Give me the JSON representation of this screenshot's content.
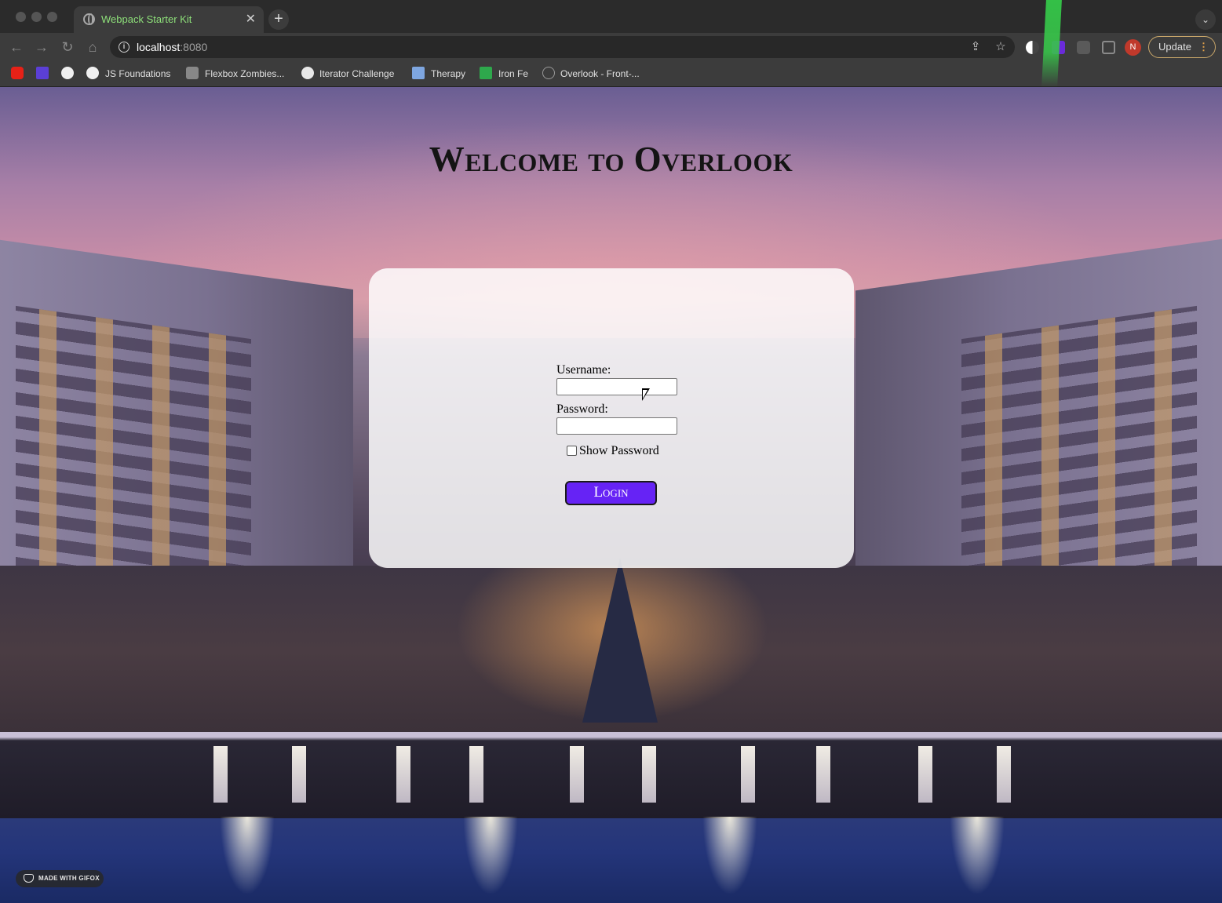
{
  "browser": {
    "tab_title": "Webpack Starter Kit",
    "tab_close": "✕",
    "new_tab": "+",
    "tab_menu": "⌄",
    "url_host": "localhost",
    "url_port": ":8080",
    "update_label": "Update",
    "update_dots": "⋮",
    "avatar_initial": "N",
    "info_glyph": "i",
    "nav": {
      "back": "←",
      "forward": "→",
      "reload": "↻",
      "home": "⌂"
    },
    "omni": {
      "share": "⇪",
      "star": "☆"
    }
  },
  "bookmarks": [
    {
      "label": "JS Foundations",
      "icon": "github-icon"
    },
    {
      "label": "Flexbox Zombies...",
      "icon": "zombie-icon"
    },
    {
      "label": "Iterator Challenge",
      "icon": "iterator-icon"
    },
    {
      "label": "Therapy",
      "icon": "therapy-icon"
    },
    {
      "label": "Iron Fe",
      "icon": "ironfe-icon"
    },
    {
      "label": "Overlook - Front-...",
      "icon": "overlook-icon"
    }
  ],
  "page": {
    "title": "Welcome to Overlook",
    "username_label": "Username:",
    "username_value": "",
    "password_label": "Password:",
    "password_value": "",
    "show_password_label": "Show Password",
    "show_password_checked": false,
    "login_label": "Login",
    "login_color": "#6623f5"
  },
  "watermark": {
    "label": "MADE WITH GIFOX"
  }
}
